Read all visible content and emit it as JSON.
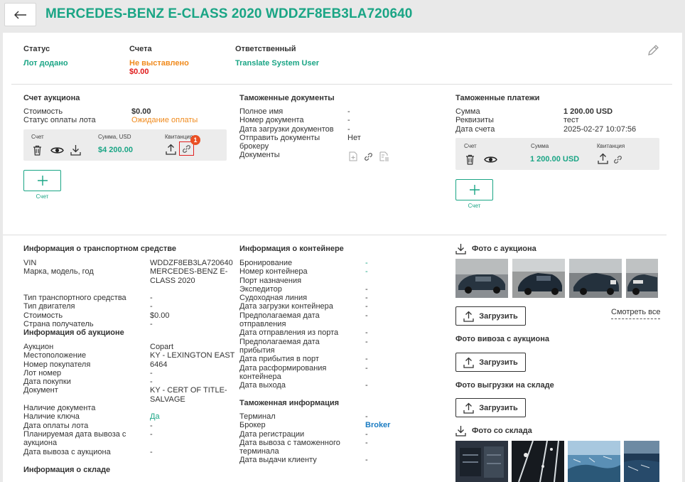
{
  "header": {
    "title": "MERCEDES-BENZ E-CLASS 2020 WDDZF8EB3LA720640"
  },
  "summary": {
    "status_label": "Статус",
    "status_value": "Лот додано",
    "invoices_label": "Счета",
    "invoices_value": "Не выставлено",
    "invoices_amount": "$0.00",
    "responsible_label": "Ответственный",
    "responsible_value": "Translate System User"
  },
  "auction_invoice": {
    "title": "Счет аукциона",
    "labels": [
      "Стоимость",
      "Статус оплаты лота"
    ],
    "cost": "$0.00",
    "payment_status": "Ожидание оплаты",
    "card_col_invoice": "Счет",
    "card_col_amount": "Сумма, USD",
    "card_col_receipt": "Квитанция",
    "card_amount": "$4 200.00",
    "badge": "1",
    "add_caption": "Счет"
  },
  "customs_docs": {
    "title": "Таможенные документы",
    "labels": [
      "Полное имя",
      "Номер документа",
      "Дата загрузки документов",
      "Отправить документы",
      "брокеру",
      "Документы"
    ],
    "values": [
      "-",
      "-",
      "-",
      "Нет"
    ]
  },
  "customs_payments": {
    "title": "Таможенные платежи",
    "labels": [
      "Сумма",
      "Реквизиты",
      "Дата счета"
    ],
    "values": [
      "1 200.00 USD",
      "тест",
      "2025-02-27 10:07:56"
    ],
    "card_col_invoice": "Счет",
    "card_col_amount": "Сумма",
    "card_col_receipt": "Квитанция",
    "card_amount": "1 200.00 USD",
    "add_caption": "Счет"
  },
  "vehicle_info": {
    "title": "Информация о транспортном средстве",
    "labels": [
      "VIN",
      "Марка, модель, год",
      "",
      "",
      "Тип транспортного средства",
      "Тип двигателя",
      "Стоимость",
      "Страна получатель"
    ],
    "values": [
      "WDDZF8EB3LA720640",
      "MERCEDES-BENZ E-",
      "CLASS 2020",
      "",
      "-",
      "-",
      "$0.00",
      "-"
    ]
  },
  "auction_info": {
    "title": "Информация об аукционе",
    "labels": [
      "Аукцион",
      "Местоположение",
      "Номер покупателя",
      "Лот номер",
      "Дата покупки",
      "Документ",
      "",
      "Наличие документа",
      "Наличие ключа",
      "Дата оплаты лота",
      "Планируемая дата вывоза с",
      "аукциона",
      "Дата вывоза с аукциона"
    ],
    "values": [
      "Copart",
      "KY - LEXINGTON EAST",
      "6464",
      "-",
      "-",
      "KY - CERT OF TITLE-",
      "SALVAGE",
      "",
      "Да",
      "-",
      "-",
      "",
      "-"
    ]
  },
  "warehouse_info": {
    "title": "Информация о складе"
  },
  "container_info": {
    "title": "Информация о контейнере",
    "labels": [
      "Бронирование",
      "Номер контейнера",
      "Порт назначения",
      "Экспедитор",
      "Судоходная линия",
      "Дата загрузки контейнера",
      "Предполагаемая дата",
      "отправления",
      "Дата отправления из порта",
      "Предполагаемая дата",
      "прибытия",
      "Дата прибытия в порт",
      "Дата расформирования",
      "контейнера",
      "Дата выхода"
    ],
    "values": [
      "-",
      "-",
      "",
      "-",
      "-",
      "-",
      "-",
      "",
      "-",
      "-",
      "",
      "-",
      "-",
      "",
      "-"
    ]
  },
  "customs_info": {
    "title": "Таможенная информация",
    "labels": [
      "Терминал",
      "Брокер",
      "Дата регистрации",
      "Дата вывоза с таможенного",
      "терминала",
      "Дата выдачи клиенту"
    ],
    "values": [
      "-",
      "Broker",
      "-",
      "-",
      "",
      "-"
    ]
  },
  "photos": {
    "auction_title": "Фото с аукциона",
    "upload_label": "Загрузить",
    "see_all": "Смотреть все",
    "pickup_title": "Фото вивоза с аукциона",
    "unload_title": "Фото выгрузки на складе",
    "warehouse_title": "Фото со склада"
  },
  "colors": {
    "accent": "#1aa585",
    "warning": "#f08a1c",
    "danger": "#e01b1b",
    "link": "#1a7bc2"
  }
}
